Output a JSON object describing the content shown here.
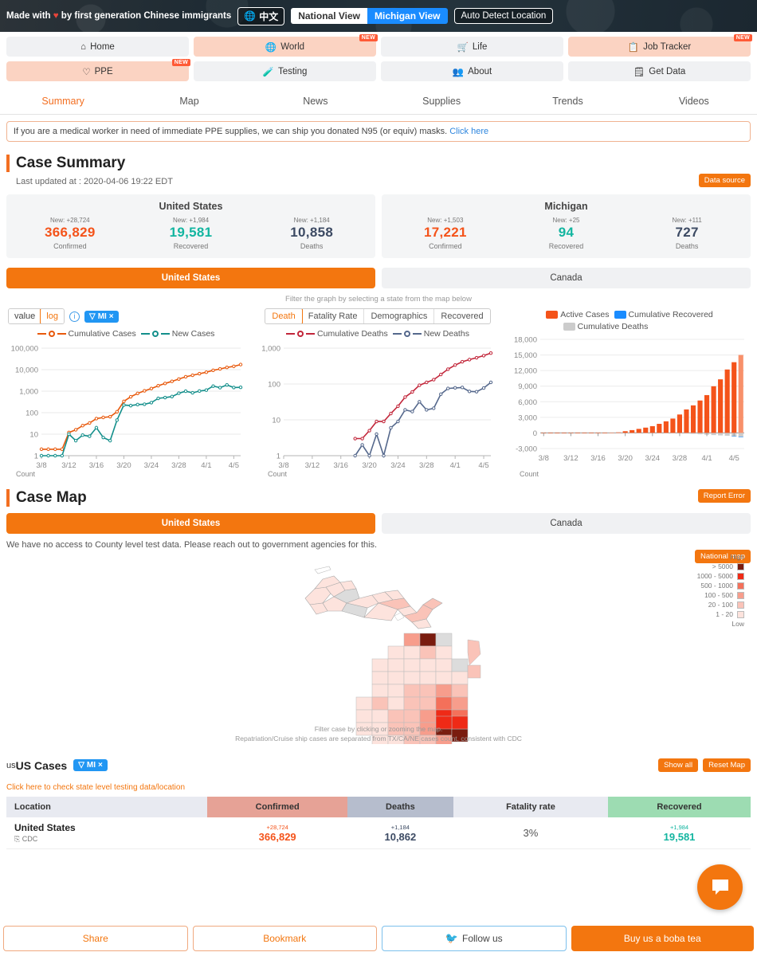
{
  "hero": {
    "made_with_prefix": "Made with ",
    "made_with_suffix": " by first generation Chinese immigrants",
    "lang_label": "中文",
    "view_national": "National View",
    "view_michigan": "Michigan View",
    "auto_detect": "Auto Detect Location"
  },
  "nav": {
    "items": [
      {
        "label": "Home",
        "icon": "home-icon",
        "highlight": false,
        "badge": ""
      },
      {
        "label": "World",
        "icon": "globe-icon",
        "highlight": true,
        "badge": "NEW"
      },
      {
        "label": "Life",
        "icon": "cart-icon",
        "highlight": false,
        "badge": ""
      },
      {
        "label": "Job Tracker",
        "icon": "clipboard-icon",
        "highlight": true,
        "badge": "NEW"
      },
      {
        "label": "PPE",
        "icon": "shield-icon",
        "highlight": true,
        "badge": "NEW"
      },
      {
        "label": "Testing",
        "icon": "flask-icon",
        "highlight": false,
        "badge": ""
      },
      {
        "label": "About",
        "icon": "people-icon",
        "highlight": false,
        "badge": ""
      },
      {
        "label": "Get Data",
        "icon": "database-icon",
        "highlight": false,
        "badge": ""
      }
    ]
  },
  "subtabs": [
    {
      "label": "Summary",
      "active": true
    },
    {
      "label": "Map",
      "active": false
    },
    {
      "label": "News",
      "active": false
    },
    {
      "label": "Supplies",
      "active": false
    },
    {
      "label": "Trends",
      "active": false
    },
    {
      "label": "Videos",
      "active": false
    }
  ],
  "alert": {
    "text": "If you are a medical worker in need of immediate PPE supplies, we can ship you donated N95 (or equiv) masks. ",
    "link": "Click here"
  },
  "case_summary": {
    "title": "Case Summary",
    "last_updated": "Last updated at : 2020-04-06 19:22 EDT",
    "data_source_btn": "Data source",
    "cards": [
      {
        "region": "United States",
        "stats": [
          {
            "new": "New: +28,724",
            "value": "366,829",
            "label": "Confirmed",
            "kind": "conf"
          },
          {
            "new": "New: +1,984",
            "value": "19,581",
            "label": "Recovered",
            "kind": "rec"
          },
          {
            "new": "New: +1,184",
            "value": "10,858",
            "label": "Deaths",
            "kind": "dea"
          }
        ]
      },
      {
        "region": "Michigan",
        "stats": [
          {
            "new": "New: +1,503",
            "value": "17,221",
            "label": "Confirmed",
            "kind": "conf"
          },
          {
            "new": "New: +25",
            "value": "94",
            "label": "Recovered",
            "kind": "rec"
          },
          {
            "new": "New: +111",
            "value": "727",
            "label": "Deaths",
            "kind": "dea"
          }
        ]
      }
    ]
  },
  "country_toggle_1": {
    "active": "United States",
    "inactive": "Canada"
  },
  "filter_hint": "Filter the graph by selecting a state from the map below",
  "chart_controls": {
    "value_label": "value",
    "log_label": "log",
    "info_icon": "info-icon",
    "state_chip": "MI",
    "chip_close": "×",
    "metric_tabs": [
      "Death",
      "Fatality Rate",
      "Demographics",
      "Recovered"
    ],
    "metric_active": "Death"
  },
  "chart_data": [
    {
      "type": "line",
      "title": "Cumulative Cases / New Cases",
      "scale": "log",
      "ylim": [
        1,
        100000
      ],
      "yticks": [
        "1",
        "10",
        "100",
        "1,000",
        "10,000",
        "100,000"
      ],
      "xticks": [
        "3/8",
        "3/12",
        "3/16",
        "3/20",
        "3/24",
        "3/28",
        "4/1",
        "4/5"
      ],
      "xlabel": "Count",
      "legend": [
        "Cumulative Cases",
        "New Cases"
      ],
      "colors": {
        "Cumulative Cases": "#e8590c",
        "New Cases": "#138f8b"
      },
      "x": [
        "3/8",
        "3/9",
        "3/10",
        "3/11",
        "3/12",
        "3/13",
        "3/14",
        "3/15",
        "3/16",
        "3/17",
        "3/18",
        "3/19",
        "3/20",
        "3/21",
        "3/22",
        "3/23",
        "3/24",
        "3/25",
        "3/26",
        "3/27",
        "3/28",
        "3/29",
        "3/30",
        "3/31",
        "4/1",
        "4/2",
        "4/3",
        "4/4",
        "4/5",
        "4/6"
      ],
      "series": [
        {
          "name": "Cumulative Cases",
          "values": [
            2,
            2,
            2,
            2,
            12,
            16,
            25,
            33,
            53,
            60,
            65,
            110,
            336,
            549,
            788,
            1035,
            1328,
            1791,
            2294,
            2856,
            3657,
            4650,
            5486,
            6498,
            7615,
            9334,
            10791,
            12744,
            14225,
            17221
          ]
        },
        {
          "name": "New Cases",
          "values": [
            1,
            1,
            1,
            1,
            10,
            5,
            9,
            8,
            20,
            7,
            5,
            45,
            226,
            213,
            239,
            247,
            293,
            463,
            503,
            562,
            801,
            993,
            836,
            1012,
            1117,
            1719,
            1457,
            1953,
            1481,
            1503
          ]
        }
      ]
    },
    {
      "type": "line",
      "title": "Cumulative Deaths / New Deaths",
      "scale": "log",
      "ylim": [
        1,
        1000
      ],
      "yticks": [
        "1",
        "10",
        "100",
        "1,000"
      ],
      "xticks": [
        "3/8",
        "3/12",
        "3/16",
        "3/20",
        "3/24",
        "3/28",
        "4/1",
        "4/5"
      ],
      "xlabel": "Count",
      "legend": [
        "Cumulative Deaths",
        "New Deaths"
      ],
      "colors": {
        "Cumulative Deaths": "#c2263a",
        "New Deaths": "#55688c"
      },
      "x": [
        "3/18",
        "3/19",
        "3/20",
        "3/21",
        "3/22",
        "3/23",
        "3/24",
        "3/25",
        "3/26",
        "3/27",
        "3/28",
        "3/29",
        "3/30",
        "3/31",
        "4/1",
        "4/2",
        "4/3",
        "4/4",
        "4/5",
        "4/6"
      ],
      "series": [
        {
          "name": "Cumulative Deaths",
          "values": [
            3,
            3,
            5,
            9,
            9,
            15,
            24,
            43,
            60,
            92,
            111,
            132,
            184,
            259,
            337,
            417,
            479,
            540,
            617,
            727
          ]
        },
        {
          "name": "New Deaths",
          "values": [
            1,
            2,
            1,
            4,
            1,
            6,
            9,
            19,
            17,
            32,
            19,
            21,
            52,
            75,
            78,
            80,
            62,
            61,
            77,
            111
          ]
        }
      ]
    },
    {
      "type": "bar",
      "title": "Active Cases / Cumulative Recovered / Cumulative Deaths",
      "ylim": [
        -3000,
        18000
      ],
      "yticks": [
        "-3,000",
        "0",
        "3,000",
        "6,000",
        "9,000",
        "12,000",
        "15,000",
        "18,000"
      ],
      "xticks": [
        "3/8",
        "3/12",
        "3/16",
        "3/20",
        "3/24",
        "3/28",
        "4/1",
        "4/5"
      ],
      "xlabel": "Count",
      "legend": [
        "Active Cases",
        "Cumulative Recovered",
        "Cumulative Deaths"
      ],
      "colors": {
        "Active Cases": "#f4531a",
        "Cumulative Recovered": "#1a8cff",
        "Cumulative Deaths": "#cccccc"
      },
      "categories": [
        "3/8",
        "3/9",
        "3/10",
        "3/11",
        "3/12",
        "3/13",
        "3/14",
        "3/15",
        "3/16",
        "3/17",
        "3/18",
        "3/19",
        "3/20",
        "3/21",
        "3/22",
        "3/23",
        "3/24",
        "3/25",
        "3/26",
        "3/27",
        "3/28",
        "3/29",
        "3/30",
        "3/31",
        "4/1",
        "4/2",
        "4/3",
        "4/4",
        "4/5",
        "4/6"
      ],
      "series": [
        {
          "name": "Active Cases",
          "values": [
            2,
            2,
            2,
            2,
            12,
            16,
            25,
            33,
            53,
            60,
            62,
            107,
            331,
            540,
            779,
            1020,
            1304,
            1748,
            2234,
            2764,
            3546,
            4518,
            5302,
            6239,
            7278,
            8977,
            10312,
            12204,
            13608,
            15000
          ]
        },
        {
          "name": "Cumulative Recovered",
          "values": [
            0,
            0,
            0,
            0,
            0,
            0,
            0,
            0,
            0,
            0,
            0,
            0,
            0,
            0,
            0,
            0,
            0,
            0,
            0,
            0,
            0,
            0,
            0,
            0,
            0,
            0,
            0,
            0,
            69,
            94
          ]
        },
        {
          "name": "Cumulative Deaths",
          "values": [
            0,
            0,
            0,
            0,
            0,
            0,
            0,
            0,
            0,
            0,
            3,
            3,
            5,
            9,
            9,
            15,
            24,
            43,
            60,
            92,
            111,
            132,
            184,
            259,
            337,
            417,
            479,
            540,
            617,
            727
          ]
        }
      ]
    }
  ],
  "case_map": {
    "title": "Case Map",
    "report_error_btn": "Report Error",
    "country_active": "United States",
    "country_inactive": "Canada",
    "county_note": "We have no access to County level test data. Please reach out to government agencies for this.",
    "national_map_btn": "National map",
    "footnote_1": "Filter case by clicking or zooming the map.",
    "footnote_2": "Repatriation/Cruise ship cases are separated from TX/CA/NE cases count, consistent with CDC",
    "legend": {
      "high_label": "High",
      "low_label": "Low",
      "bands": [
        {
          "label": "> 5000",
          "color": "#7a1c0f"
        },
        {
          "label": "1000 - 5000",
          "color": "#ef2a16"
        },
        {
          "label": "500 - 1000",
          "color": "#f4705a"
        },
        {
          "label": "100 - 500",
          "color": "#f79d8c"
        },
        {
          "label": "20 - 100",
          "color": "#fac3b8"
        },
        {
          "label": "1 - 20",
          "color": "#fde3dd"
        }
      ]
    }
  },
  "table_section": {
    "prefix": "us",
    "title": "US Cases",
    "chip": "MI",
    "chip_close": "×",
    "show_all_btn": "Show all",
    "reset_map_btn": "Reset Map",
    "testing_link": "Click here to check state level testing data/location",
    "columns": [
      "Location",
      "Confirmed",
      "Deaths",
      "Fatality rate",
      "Recovered"
    ],
    "rows": [
      {
        "location": "United States",
        "source": "CDC",
        "confirmed_delta": "+28,724",
        "confirmed": "366,829",
        "deaths_delta": "+1,184",
        "deaths": "10,862",
        "fatality": "3%",
        "recovered_delta": "+1,984",
        "recovered": "19,581"
      }
    ]
  },
  "footer": {
    "share": "Share",
    "bookmark": "Bookmark",
    "follow": "Follow us",
    "boba": "Buy us a boba tea"
  }
}
